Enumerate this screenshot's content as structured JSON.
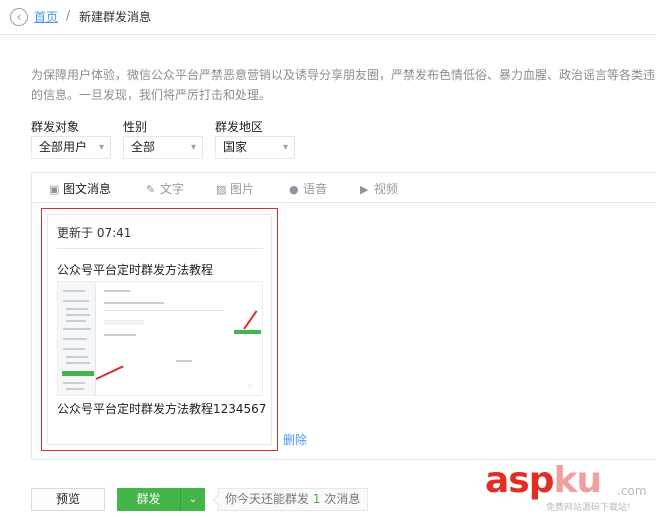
{
  "breadcrumb": {
    "home": "首页",
    "separator": "/",
    "current": "新建群发消息"
  },
  "notice": {
    "line1": "为保障用户体验，微信公众平台严禁恶意营销以及诱导分享朋友圈，严禁发布色情低俗、暴力血腥、政治谣言等各类违",
    "line2": "的信息。一旦发现，我们将严厉打击和处理。"
  },
  "filters": [
    {
      "label": "群发对象",
      "value": "全部用户"
    },
    {
      "label": "性别",
      "value": "全部"
    },
    {
      "label": "群发地区",
      "value": "国家"
    }
  ],
  "tabs": [
    {
      "label": "图文消息",
      "icon": "image-text-icon",
      "active": true
    },
    {
      "label": "文字",
      "icon": "pencil-icon",
      "active": false
    },
    {
      "label": "图片",
      "icon": "picture-icon",
      "active": false
    },
    {
      "label": "语音",
      "icon": "microphone-icon",
      "active": false
    },
    {
      "label": "视频",
      "icon": "video-icon",
      "active": false
    }
  ],
  "card": {
    "updated": "更新于 07:41",
    "title": "公众号平台定时群发方法教程",
    "description": "公众号平台定时群发方法教程1234567",
    "border_color": "#e02e24"
  },
  "delete_label": "删除",
  "actions": {
    "preview": "预览",
    "send": "群发",
    "quota_prefix": "你今天还能群发",
    "quota_count": "1",
    "quota_suffix": "次消息"
  },
  "watermark": {
    "asp": "asp",
    "ku": "ku",
    "com": ".com",
    "sub": "免费网站源码下载站!"
  },
  "colors": {
    "accent": "#44b549",
    "link": "#459ae9",
    "alert": "#e02e24"
  }
}
